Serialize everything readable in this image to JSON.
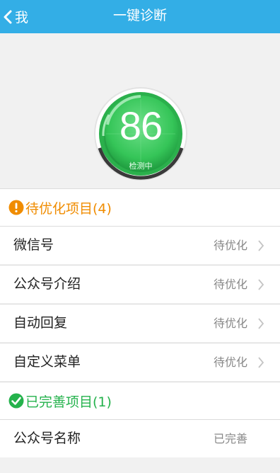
{
  "header": {
    "back_label": "我",
    "title": "一键诊断"
  },
  "diagnosis": {
    "score": "86",
    "status": "检测中",
    "ring_color": "#3ac55f"
  },
  "pending_section": {
    "title": "待优化项目(4)",
    "color": "#f08c00"
  },
  "pending_items": [
    {
      "label": "微信号",
      "state": "待优化"
    },
    {
      "label": "公众号介绍",
      "state": "待优化"
    },
    {
      "label": "自动回复",
      "state": "待优化"
    },
    {
      "label": "自定义菜单",
      "state": "待优化"
    }
  ],
  "done_section": {
    "title": "已完善项目(1)",
    "color": "#24b24c"
  },
  "done_items": [
    {
      "label": "公众号名称",
      "state": "已完善"
    }
  ]
}
